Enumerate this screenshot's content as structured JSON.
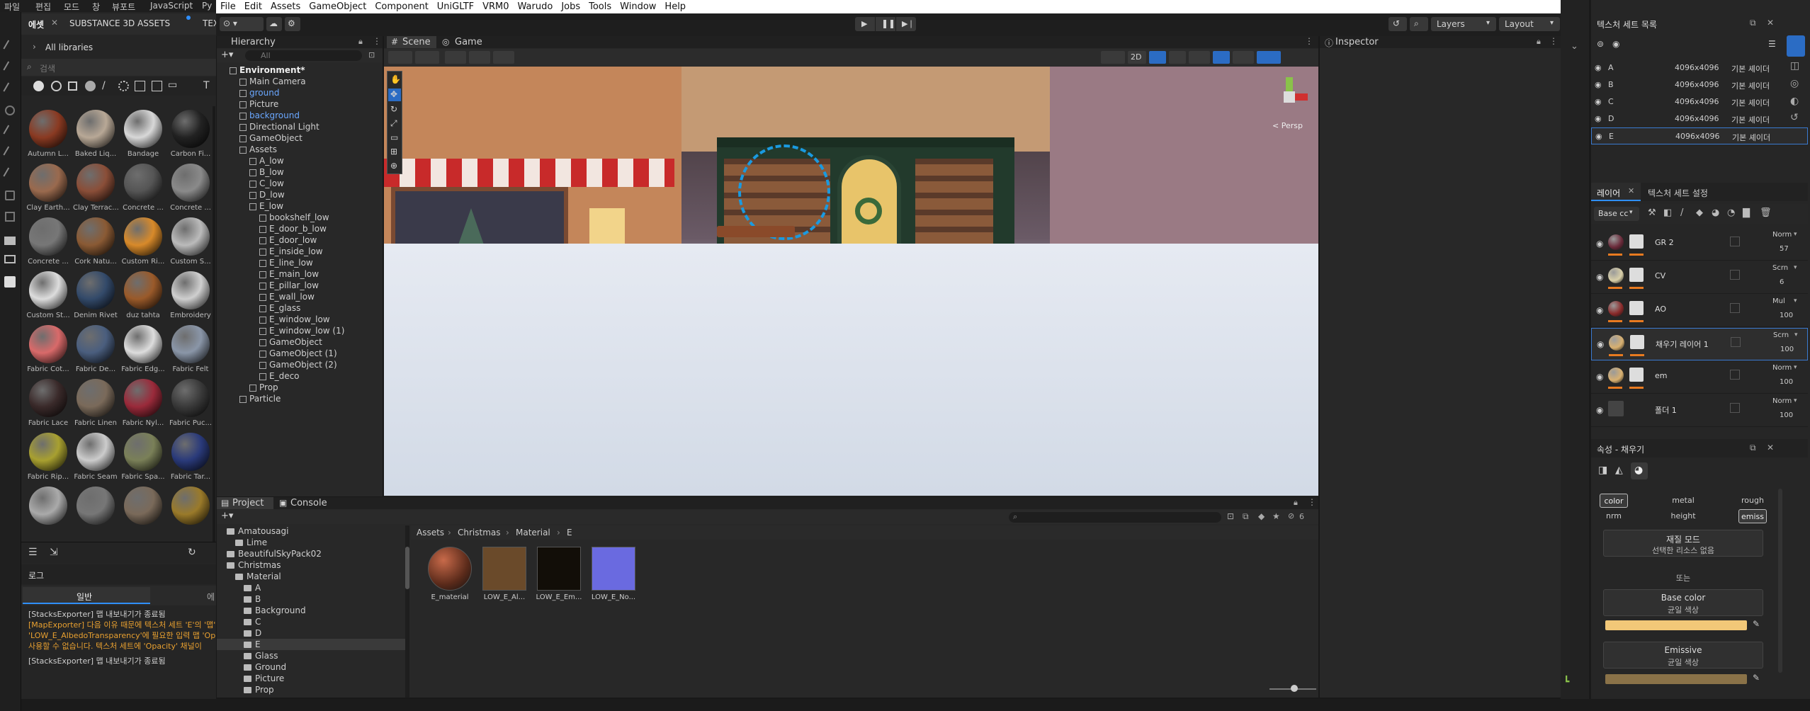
{
  "painter_left": {
    "top_menu": [
      "파일",
      "편집",
      "모드",
      "창",
      "뷰포트",
      "JavaScript",
      "Py"
    ],
    "tabs": [
      "에셋",
      "SUBSTANCE 3D ASSETS",
      "TEXTURE"
    ],
    "library_label": "All libraries",
    "search_placeholder": "검색",
    "materials": [
      {
        "name": "Autumn L...",
        "color": "#8a3a22"
      },
      {
        "name": "Baked Liq...",
        "color": "#b8a896"
      },
      {
        "name": "Bandage",
        "color": "#d8d8d8"
      },
      {
        "name": "Carbon Fi...",
        "color": "#222"
      },
      {
        "name": "Clay Earth...",
        "color": "#9a6a4e"
      },
      {
        "name": "Clay Terrac...",
        "color": "#8a4e38"
      },
      {
        "name": "Concrete ...",
        "color": "#555"
      },
      {
        "name": "Concrete ...",
        "color": "#8a8a8a"
      },
      {
        "name": "Concrete ...",
        "color": "#777"
      },
      {
        "name": "Cork Natu...",
        "color": "#8a5a34"
      },
      {
        "name": "Custom Ri...",
        "color": "#d88a2a"
      },
      {
        "name": "Custom S...",
        "color": "#bbb"
      },
      {
        "name": "Custom St...",
        "color": "#ddd"
      },
      {
        "name": "Denim Rivet",
        "color": "#334a6a"
      },
      {
        "name": "duz tahta",
        "color": "#9a5a2a"
      },
      {
        "name": "Embroidery",
        "color": "#cfcfcf"
      },
      {
        "name": "Fabric Cot...",
        "color": "#d96a6a"
      },
      {
        "name": "Fabric De...",
        "color": "#4a5e7e"
      },
      {
        "name": "Fabric Edg...",
        "color": "#ddd"
      },
      {
        "name": "Fabric Felt",
        "color": "#8a96a8"
      },
      {
        "name": "Fabric Lace",
        "color": "#3a2a2a"
      },
      {
        "name": "Fabric Linen",
        "color": "#7a6a5a"
      },
      {
        "name": "Fabric Nyl...",
        "color": "#9a2a3a"
      },
      {
        "name": "Fabric Puc...",
        "color": "#3a3a3a"
      },
      {
        "name": "Fabric Rip...",
        "color": "#a8a030"
      },
      {
        "name": "Fabric Seam",
        "color": "#ccc"
      },
      {
        "name": "Fabric Spa...",
        "color": "#7a8058"
      },
      {
        "name": "Fabric Tar...",
        "color": "#2a3a7a"
      },
      {
        "name": "",
        "color": "#aaa"
      },
      {
        "name": "",
        "color": "#777"
      },
      {
        "name": "",
        "color": "#7a6a5a"
      },
      {
        "name": "",
        "color": "#9a7a2a"
      }
    ],
    "log_title": "로그",
    "log_tabs": [
      "일반",
      "에"
    ],
    "log_lines": [
      {
        "text": "[StacksExporter] 맵 내보내기가 종료됨",
        "color": "#cfcfcf"
      },
      {
        "text": "[MapExporter] 다음 이유 때문에 텍스처 세트 'E'의 '맵'",
        "color": "#e8a030"
      },
      {
        "text": "'LOW_E_AlbedoTransparency'에 필요한 입력 맵 'Op",
        "color": "#e8a030"
      },
      {
        "text": "사용할 수 없습니다. 텍스처 세트에 'Opacity' 채널이",
        "color": "#e8a030"
      },
      {
        "text": "[StacksExporter] 맵 내보내기가 종료됨",
        "color": "#cfcfcf"
      }
    ]
  },
  "unity": {
    "menu": [
      "File",
      "Edit",
      "Assets",
      "GameObject",
      "Component",
      "UniGLTF",
      "VRM0",
      "Warudo",
      "Jobs",
      "Tools",
      "Window",
      "Help"
    ],
    "toolbar": {
      "layers": "Layers",
      "layout": "Layout"
    },
    "hierarchy_tab": "Hierarchy",
    "hierarchy_search_placeholder": "All",
    "hierarchy": [
      {
        "label": "Environment*",
        "depth": 0,
        "style": "bold"
      },
      {
        "label": "Main Camera",
        "depth": 1
      },
      {
        "label": "ground",
        "depth": 1,
        "style": "blue"
      },
      {
        "label": "Picture",
        "depth": 1
      },
      {
        "label": "background",
        "depth": 1,
        "style": "blue"
      },
      {
        "label": "Directional Light",
        "depth": 1
      },
      {
        "label": "GameObject",
        "depth": 1
      },
      {
        "label": "Assets",
        "depth": 1
      },
      {
        "label": "A_low",
        "depth": 2
      },
      {
        "label": "B_low",
        "depth": 2
      },
      {
        "label": "C_low",
        "depth": 2
      },
      {
        "label": "D_low",
        "depth": 2
      },
      {
        "label": "E_low",
        "depth": 2
      },
      {
        "label": "bookshelf_low",
        "depth": 3
      },
      {
        "label": "E_door_b_low",
        "depth": 3
      },
      {
        "label": "E_door_low",
        "depth": 3
      },
      {
        "label": "E_inside_low",
        "depth": 3
      },
      {
        "label": "E_line_low",
        "depth": 3
      },
      {
        "label": "E_main_low",
        "depth": 3
      },
      {
        "label": "E_pillar_low",
        "depth": 3
      },
      {
        "label": "E_wall_low",
        "depth": 3
      },
      {
        "label": "E_glass",
        "depth": 3
      },
      {
        "label": "E_window_low",
        "depth": 3
      },
      {
        "label": "E_window_low (1)",
        "depth": 3
      },
      {
        "label": "GameObject",
        "depth": 3
      },
      {
        "label": "GameObject (1)",
        "depth": 3
      },
      {
        "label": "GameObject (2)",
        "depth": 3
      },
      {
        "label": "E_deco",
        "depth": 3
      },
      {
        "label": "Prop",
        "depth": 2
      },
      {
        "label": "Particle",
        "depth": 1
      }
    ],
    "scene_tabs": [
      "Scene",
      "Game"
    ],
    "scene_2d": "2D",
    "persp": "< Persp",
    "inspector_tab": "Inspector",
    "project_tab": "Project",
    "console_tab": "Console",
    "folders": [
      {
        "label": "Amatousagi",
        "depth": 0
      },
      {
        "label": "Lime",
        "depth": 1
      },
      {
        "label": "BeautifulSkyPack02",
        "depth": 0
      },
      {
        "label": "Christmas",
        "depth": 0
      },
      {
        "label": "Material",
        "depth": 1
      },
      {
        "label": "A",
        "depth": 2
      },
      {
        "label": "B",
        "depth": 2
      },
      {
        "label": "Background",
        "depth": 2
      },
      {
        "label": "C",
        "depth": 2
      },
      {
        "label": "D",
        "depth": 2
      },
      {
        "label": "E",
        "depth": 2
      },
      {
        "label": "Glass",
        "depth": 2
      },
      {
        "label": "Ground",
        "depth": 2
      },
      {
        "label": "Picture",
        "depth": 2
      },
      {
        "label": "Prop",
        "depth": 2
      }
    ],
    "breadcrumb": [
      "Assets",
      "Christmas",
      "Material",
      "E"
    ],
    "assets": [
      {
        "name": "E_material",
        "color": "#5a2a1a"
      },
      {
        "name": "LOW_E_Al...",
        "color": "#6a4a2a"
      },
      {
        "name": "LOW_E_Em...",
        "color": "#120e08"
      },
      {
        "name": "LOW_E_No...",
        "color": "#6a6ae0"
      }
    ],
    "asset_count": "6"
  },
  "painter_right": {
    "texset_title": "텍스처 세트 목록",
    "texsets": [
      {
        "name": "A",
        "res": "4096x4096",
        "shader": "기본 셰이더"
      },
      {
        "name": "B",
        "res": "4096x4096",
        "shader": "기본 셰이더"
      },
      {
        "name": "C",
        "res": "4096x4096",
        "shader": "기본 셰이더"
      },
      {
        "name": "D",
        "res": "4096x4096",
        "shader": "기본 셰이더"
      },
      {
        "name": "E",
        "res": "4096x4096",
        "shader": "기본 셰이더"
      }
    ],
    "layer_tabs": [
      "레이어",
      "텍스처 세트 설정"
    ],
    "channel": "Base cc",
    "layers": [
      {
        "name": "GR 2",
        "blend": "Norm",
        "opacity": "57",
        "color": "#6a2a3a"
      },
      {
        "name": "CV",
        "blend": "Scrn",
        "opacity": "6",
        "color": "#d8cfa8"
      },
      {
        "name": "AO",
        "blend": "Mul",
        "opacity": "100",
        "color": "#8a2a2a"
      },
      {
        "name": "채우기 레이어 1",
        "blend": "Scrn",
        "opacity": "100",
        "color": "#d8b070"
      },
      {
        "name": "em",
        "blend": "Norm",
        "opacity": "100",
        "color": "#d8b070"
      },
      {
        "name": "폴더 1",
        "blend": "Norm",
        "opacity": "100",
        "color": "#555"
      }
    ],
    "props_title": "속성 - 채우기",
    "channels": [
      "color",
      "metal",
      "rough",
      "nrm",
      "height",
      "emiss"
    ],
    "material_mode": "재질 모드",
    "material_mode_sub": "선택한 리소스 없음",
    "or": "또는",
    "base_color": "Base color",
    "base_color_sub": "균일 색상",
    "base_color_value": "#f2c878",
    "emissive": "Emissive",
    "emissive_sub": "균일 색상",
    "emissive_value": "#8a7248"
  }
}
